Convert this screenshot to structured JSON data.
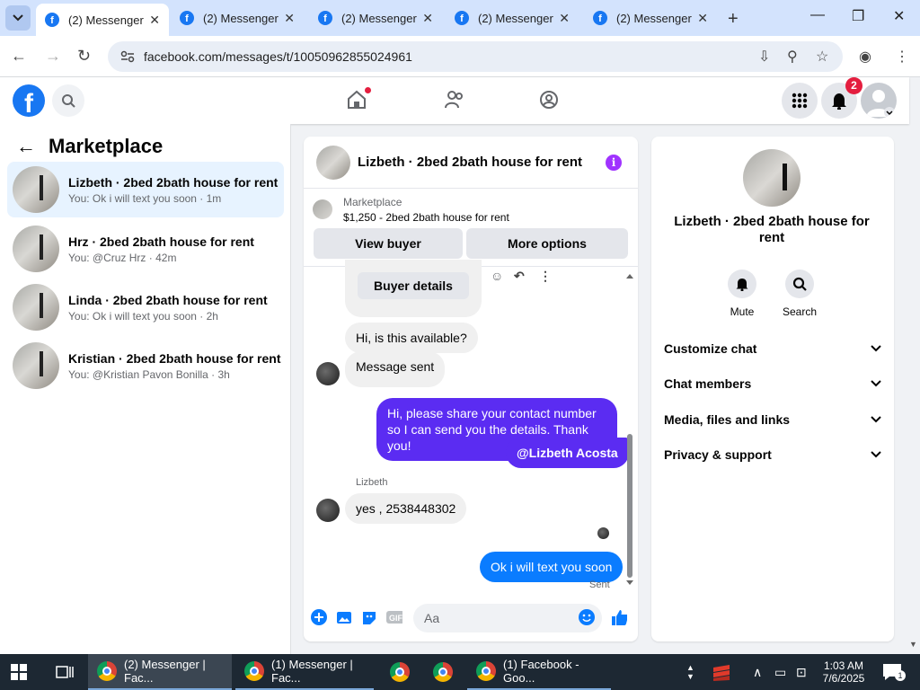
{
  "browser": {
    "tabs": [
      {
        "label": "(2) Messenger |"
      },
      {
        "label": "(2) Messenger |"
      },
      {
        "label": "(2) Messenger |"
      },
      {
        "label": "(2) Messenger |"
      },
      {
        "label": "(2) Messenger |"
      }
    ],
    "url": "facebook.com/messages/t/10050962855024961"
  },
  "header": {
    "notification_count": "2"
  },
  "sidebar": {
    "title": "Marketplace",
    "conversations": [
      {
        "name": "Lizbeth · 2bed 2bath house for rent",
        "preview": "You: Ok i will text you soon · 1m"
      },
      {
        "name": "Hrz · 2bed 2bath house for rent",
        "preview": "You: @Cruz Hrz · 42m"
      },
      {
        "name": "Linda · 2bed 2bath house for rent",
        "preview": "You: Ok i will text you soon · 2h"
      },
      {
        "name": "Kristian · 2bed 2bath house for rent",
        "preview": "You: @Kristian Pavon Bonilla · 3h"
      }
    ]
  },
  "chat": {
    "title": "Lizbeth · 2bed 2bath house for rent",
    "marketplace_label": "Marketplace",
    "listing": "$1,250 - 2bed 2bath house for rent",
    "view_buyer": "View buyer",
    "more_options": "More options",
    "buyer_details": "Buyer details",
    "messages": [
      {
        "text": "Hi, is this available?"
      },
      {
        "text": "Message sent"
      },
      {
        "text": "Hi, please share your contact number so I can send you the details. Thank you!"
      },
      {
        "text": "@Lizbeth Acosta"
      },
      {
        "text": "yes , 2538448302"
      },
      {
        "text": "Ok i will text you soon"
      }
    ],
    "sender_label": "Lizbeth",
    "status": "Sent",
    "composer_placeholder": "Aa"
  },
  "details": {
    "name": "Lizbeth · 2bed 2bath house for rent",
    "mute": "Mute",
    "search": "Search",
    "sections": [
      "Customize chat",
      "Chat members",
      "Media, files and links",
      "Privacy & support"
    ]
  },
  "taskbar": {
    "items": [
      {
        "label": "(2) Messenger | Fac..."
      },
      {
        "label": "(1) Messenger | Fac..."
      },
      {
        "label": "(1) Facebook - Goo..."
      }
    ],
    "time": "1:03 AM",
    "date": "7/6/2025",
    "notif": "1"
  },
  "colors": {
    "fb_blue": "#1877f2",
    "outgoing_purple": "#5b2cf2",
    "outgoing_blue": "#0a7cff",
    "selected_row": "#e7f3ff"
  }
}
